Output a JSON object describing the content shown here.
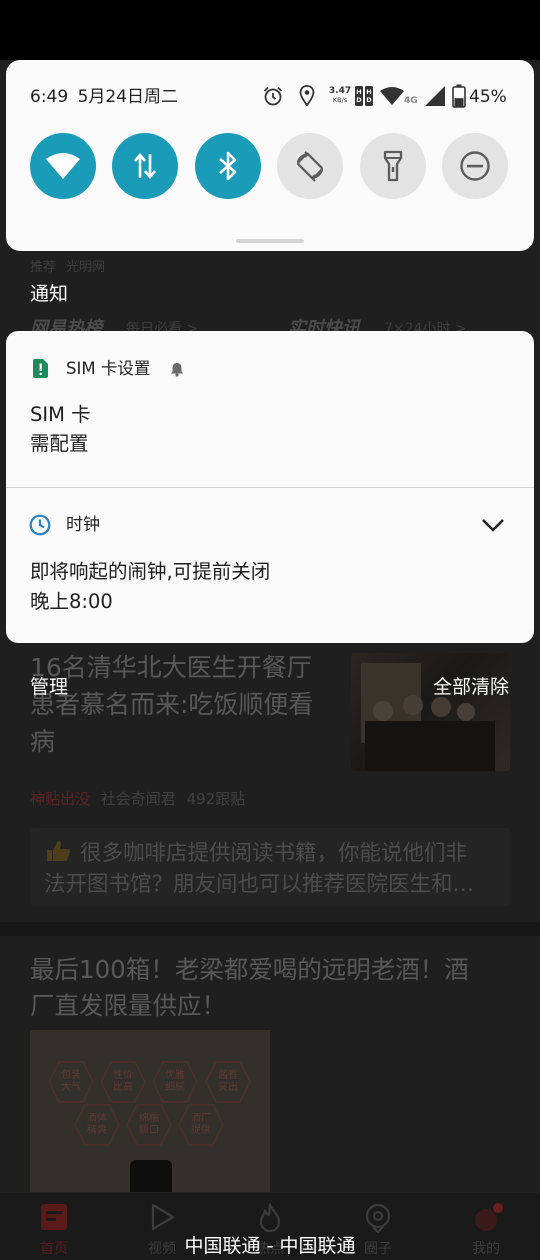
{
  "status": {
    "time": "6:49",
    "date": "5月24日周二",
    "speed_value": "3.47",
    "speed_unit": "KB/s",
    "network_type": "4G",
    "battery": "45%",
    "battery_level": 0.45
  },
  "quick_settings": [
    {
      "label": "wifi",
      "icon": "wifi-icon",
      "active": true
    },
    {
      "label": "mobile-data",
      "icon": "data-arrows-icon",
      "active": true
    },
    {
      "label": "bluetooth",
      "icon": "bluetooth-icon",
      "active": true
    },
    {
      "label": "auto-rotate",
      "icon": "rotate-icon",
      "active": false
    },
    {
      "label": "flashlight",
      "icon": "flashlight-icon",
      "active": false
    },
    {
      "label": "do-not-disturb",
      "icon": "dnd-icon",
      "active": false
    }
  ],
  "shade": {
    "notifications_header": "通知",
    "manage": "管理",
    "clear_all": "全部清除",
    "carrier": "中国联通 - 中国联通"
  },
  "notifications": [
    {
      "app": "SIM 卡设置",
      "icon": "sim-alert-icon",
      "title": "SIM 卡",
      "text": "需配置"
    },
    {
      "app": "时钟",
      "icon": "clock-icon",
      "title": "即将响起的闹钟,可提前关闭",
      "text": "晚上8:00"
    }
  ],
  "background_app": {
    "tabs": [
      "推荐",
      "光明网"
    ],
    "hot_list": {
      "title": "网易热榜",
      "sub": "每日必看 >"
    },
    "flash_news": {
      "title": "实时快讯",
      "sub": "7×24小时 >"
    },
    "article1": {
      "title_lines": [
        "16名清华北大医生开餐厅",
        "患者慕名而来:吃饭顺便看",
        "病"
      ],
      "tag": "神贴出没",
      "source": "社会奇闻君",
      "comments": "492跟贴",
      "quote_lines": [
        "很多咖啡店提供阅读书籍，你能说他们非",
        "法开图书馆？朋友间也可以推荐医院医生和…"
      ]
    },
    "article2": {
      "title_lines": [
        "最后100箱！老梁都爱喝的远明老酒！酒",
        "厂直发限量供应！"
      ],
      "ad_badges": [
        "包装大气",
        "性价比高",
        "优雅细腻",
        "酱香突出",
        "酒体稠爽",
        "绵糯顺口",
        "酒厂提供"
      ]
    },
    "nav": [
      "首页",
      "视频",
      "热点",
      "圈子",
      "我的"
    ]
  },
  "colors": {
    "tile_active": "#1a9bb8",
    "tile_inactive": "#e3e3e3",
    "sim_icon": "#1f8a5b",
    "clock_icon": "#2a7fc6",
    "nav_active": "#5a1a1a"
  }
}
